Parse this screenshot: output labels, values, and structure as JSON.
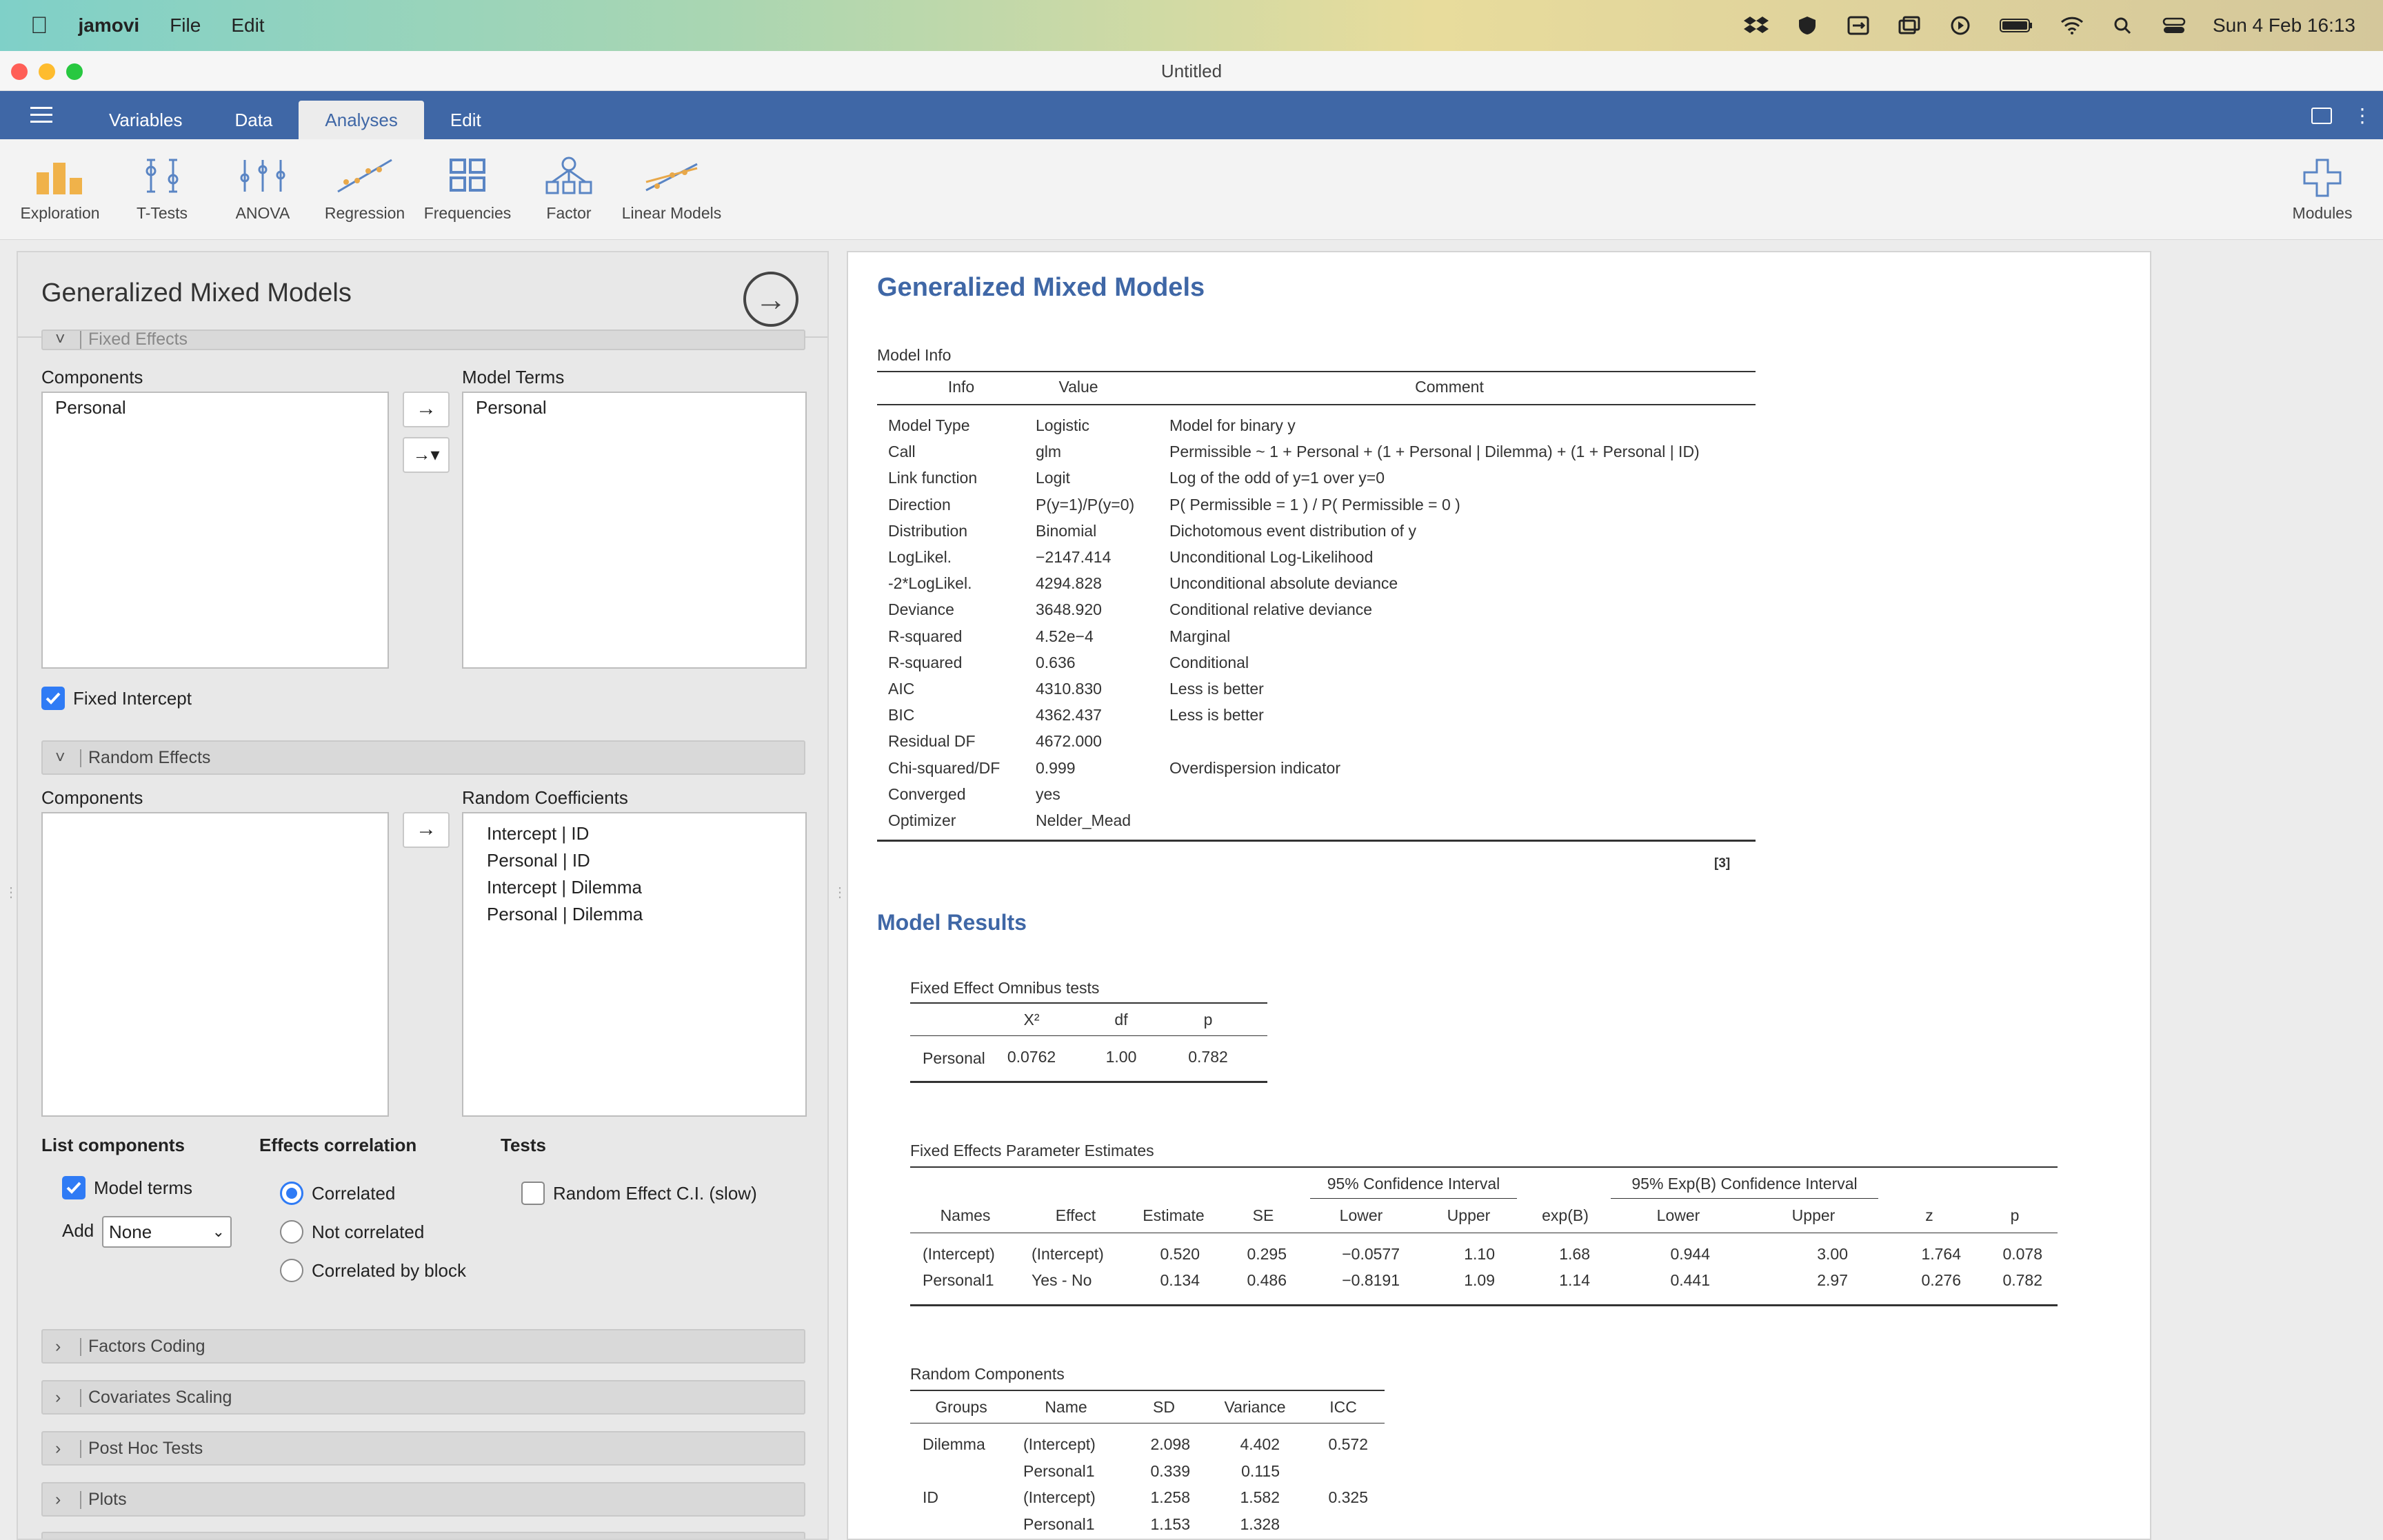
{
  "menubar": {
    "app": "jamovi",
    "items": [
      "File",
      "Edit"
    ],
    "datetime": "Sun 4 Feb  16:13"
  },
  "window": {
    "title": "Untitled"
  },
  "nav": {
    "tabs": [
      "Variables",
      "Data",
      "Analyses",
      "Edit"
    ],
    "active": "Analyses"
  },
  "ribbon": {
    "items": [
      "Exploration",
      "T-Tests",
      "ANOVA",
      "Regression",
      "Frequencies",
      "Factor",
      "Linear Models"
    ],
    "modules": "Modules"
  },
  "left": {
    "title": "Generalized Mixed Models",
    "fixed_header": "Fixed Effects",
    "components_label": "Components",
    "model_terms_label": "Model Terms",
    "fixed_components": [
      "Personal"
    ],
    "model_terms": [
      "Personal"
    ],
    "fixed_intercept": "Fixed Intercept",
    "random_header": "Random Effects",
    "random_components_label": "Components",
    "random_coef_label": "Random Coefficients",
    "random_coefs": [
      "Intercept | ID",
      "Personal | ID",
      "Intercept | Dilemma",
      "Personal | Dilemma"
    ],
    "list_components": "List components",
    "model_terms_opt": "Model terms",
    "add_label": "Add",
    "add_value": "None",
    "effects_corr": "Effects correlation",
    "corr_opts": [
      "Correlated",
      "Not correlated",
      "Correlated by block"
    ],
    "tests": "Tests",
    "re_ci": "Random Effect C.I. (slow)",
    "sections": [
      "Factors Coding",
      "Covariates Scaling",
      "Post Hoc Tests",
      "Plots"
    ]
  },
  "results": {
    "title": "Generalized Mixed Models",
    "model_info": {
      "caption": "Model Info",
      "headers": [
        "Info",
        "Value",
        "Comment"
      ],
      "rows": [
        [
          "Model Type",
          "Logistic",
          "Model for binary y"
        ],
        [
          "Call",
          "glm",
          "Permissible ~ 1 + Personal + (1 + Personal | Dilemma) + (1 + Personal | ID)"
        ],
        [
          "Link function",
          "Logit",
          "Log of the odd of y=1 over y=0"
        ],
        [
          "Direction",
          "P(y=1)/P(y=0)",
          "P( Permissible = 1 ) / P( Permissible = 0 )"
        ],
        [
          "Distribution",
          "Binomial",
          "Dichotomous event distribution of y"
        ],
        [
          "LogLikel.",
          "−2147.414",
          "Unconditional Log-Likelihood"
        ],
        [
          "-2*LogLikel.",
          "4294.828",
          "Unconditional absolute deviance"
        ],
        [
          "Deviance",
          "3648.920",
          "Conditional relative deviance"
        ],
        [
          "R-squared",
          "4.52e−4",
          "Marginal"
        ],
        [
          "R-squared",
          "0.636",
          "Conditional"
        ],
        [
          "AIC",
          "4310.830",
          "Less is better"
        ],
        [
          "BIC",
          "4362.437",
          "Less is better"
        ],
        [
          "Residual DF",
          "4672.000",
          ""
        ],
        [
          "Chi-squared/DF",
          "0.999",
          "Overdispersion indicator"
        ],
        [
          "Converged",
          "yes",
          ""
        ],
        [
          "Optimizer",
          "Nelder_Mead",
          ""
        ]
      ],
      "footnote": "[3]"
    },
    "model_results_title": "Model Results",
    "omnibus": {
      "caption": "Fixed Effect Omnibus tests",
      "headers": [
        "",
        "X²",
        "df",
        "p"
      ],
      "rows": [
        [
          "Personal",
          "0.0762",
          "1.00",
          "0.782"
        ]
      ]
    },
    "estimates": {
      "caption": "Fixed Effects Parameter Estimates",
      "ci_label": "95% Confidence Interval",
      "expci_label": "95% Exp(B) Confidence Interval",
      "headers": [
        "Names",
        "Effect",
        "Estimate",
        "SE",
        "Lower",
        "Upper",
        "exp(B)",
        "Lower",
        "Upper",
        "z",
        "p"
      ],
      "rows": [
        [
          "(Intercept)",
          "(Intercept)",
          "0.520",
          "0.295",
          "−0.0577",
          "1.10",
          "1.68",
          "0.944",
          "3.00",
          "1.764",
          "0.078"
        ],
        [
          "Personal1",
          "Yes - No",
          "0.134",
          "0.486",
          "−0.8191",
          "1.09",
          "1.14",
          "0.441",
          "2.97",
          "0.276",
          "0.782"
        ]
      ]
    },
    "random": {
      "caption": "Random Components",
      "headers": [
        "Groups",
        "Name",
        "SD",
        "Variance",
        "ICC"
      ],
      "rows": [
        [
          "Dilemma",
          "(Intercept)",
          "2.098",
          "4.402",
          "0.572"
        ],
        [
          "",
          "Personal1",
          "0.339",
          "0.115",
          ""
        ],
        [
          "ID",
          "(Intercept)",
          "1.258",
          "1.582",
          "0.325"
        ],
        [
          "",
          "Personal1",
          "1.153",
          "1.328",
          ""
        ]
      ]
    }
  }
}
